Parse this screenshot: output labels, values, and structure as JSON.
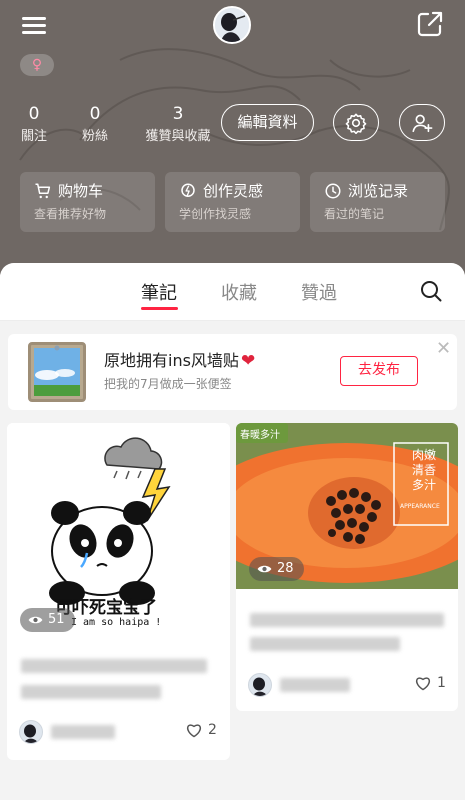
{
  "header": {
    "stats": [
      {
        "count": "0",
        "label": "關注"
      },
      {
        "count": "0",
        "label": "粉絲"
      },
      {
        "count": "3",
        "label": "獲贊與收藏"
      }
    ],
    "gender_symbol": "♀",
    "edit_profile_label": "編輯資料",
    "quick_links": [
      {
        "title": "购物车",
        "subtitle": "查看推荐好物",
        "icon": "cart-icon"
      },
      {
        "title": "创作灵感",
        "subtitle": "学创作找灵感",
        "icon": "bulb-icon"
      },
      {
        "title": "浏览记录",
        "subtitle": "看过的笔记",
        "icon": "clock-icon"
      }
    ]
  },
  "tabs": [
    "筆記",
    "收藏",
    "贊過"
  ],
  "active_tab": 0,
  "promo": {
    "title": "原地拥有ins风墙贴",
    "subtitle": "把我的7月做成一张便签",
    "button_label": "去发布",
    "close_symbol": "✕"
  },
  "notes": [
    {
      "caption": "可吓死宝宝了",
      "caption_en": "I am so haipa !",
      "views": "51",
      "likes": "2"
    },
    {
      "tag": "春暖多汁",
      "overlay_text": [
        "肉嫩",
        "清香",
        "多汁"
      ],
      "overlay_en": "APPEARANCE",
      "views": "28",
      "likes": "1"
    }
  ],
  "colors": {
    "header_bg": "#6f6864",
    "accent": "#ff2442",
    "page_bg": "#f3f3f3"
  }
}
